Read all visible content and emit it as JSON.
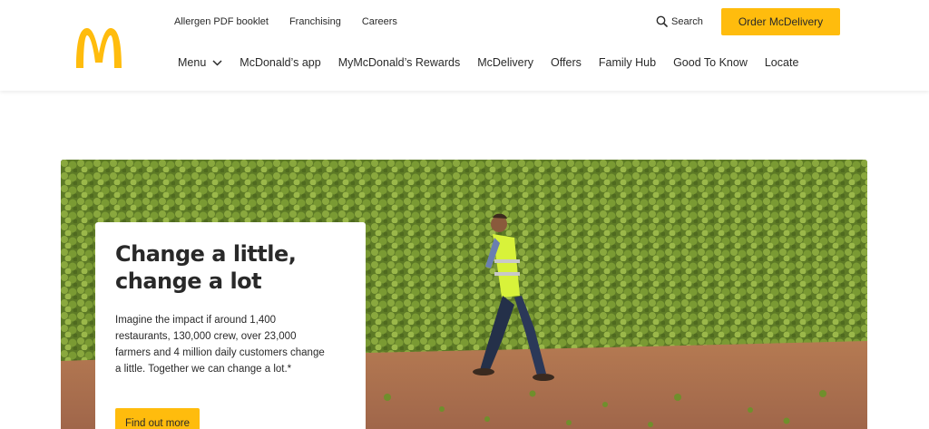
{
  "brand": {
    "logo_icon": "golden-arches-icon",
    "accent": "#ffbc0d",
    "logo_color": "#ffbc0d"
  },
  "utility_nav": [
    "Allergen PDF booklet",
    "Franchising",
    "Careers"
  ],
  "search": {
    "label": "Search",
    "icon": "search-icon"
  },
  "order_button": "Order McDelivery",
  "main_nav": {
    "menu_label": "Menu",
    "items": [
      "McDonald’s app",
      "MyMcDonald’s Rewards",
      "McDelivery",
      "Offers",
      "Family Hub",
      "Good To Know",
      "Locate"
    ]
  },
  "hero": {
    "title": "Change a little, change a lot",
    "body": "Imagine the impact if around 1,400 restaurants, 130,000 crew, over 23,000 farmers and 4 million daily customers change a little. Together we can change a lot.*",
    "button": "Find out more"
  }
}
